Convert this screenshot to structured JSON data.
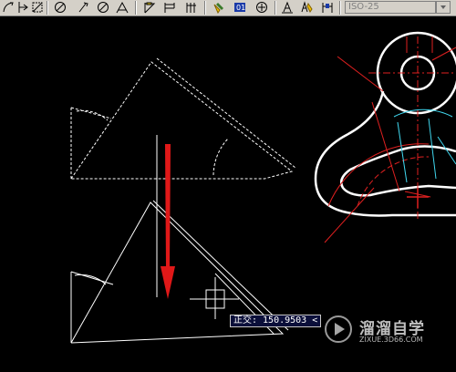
{
  "toolbar": {
    "dim_style_value": "ISO-25",
    "icons": [
      "arc-dim-icon",
      "ordinate-dim-icon",
      "radius-dim-icon",
      "diameter-dim-icon",
      "angular-dim-icon",
      "quick-dim-icon",
      "baseline-dim-icon",
      "continue-dim-icon",
      "qleader-icon",
      "tolerance-icon",
      "center-mark-icon",
      "dim-edit-icon",
      "dim-text-edit-icon",
      "dim-update-icon"
    ]
  },
  "drawing": {
    "dynamic_input_text": "正交: 150.9503 <"
  },
  "watermark": {
    "name": "溜溜自学",
    "url": "ZIXUE.3D66.COM"
  },
  "colors": {
    "canvas_bg": "#000000",
    "arrow": "#e01818",
    "geometry": "#ffffff",
    "centerline": "#e02020",
    "dimension": "#40d8f0"
  }
}
